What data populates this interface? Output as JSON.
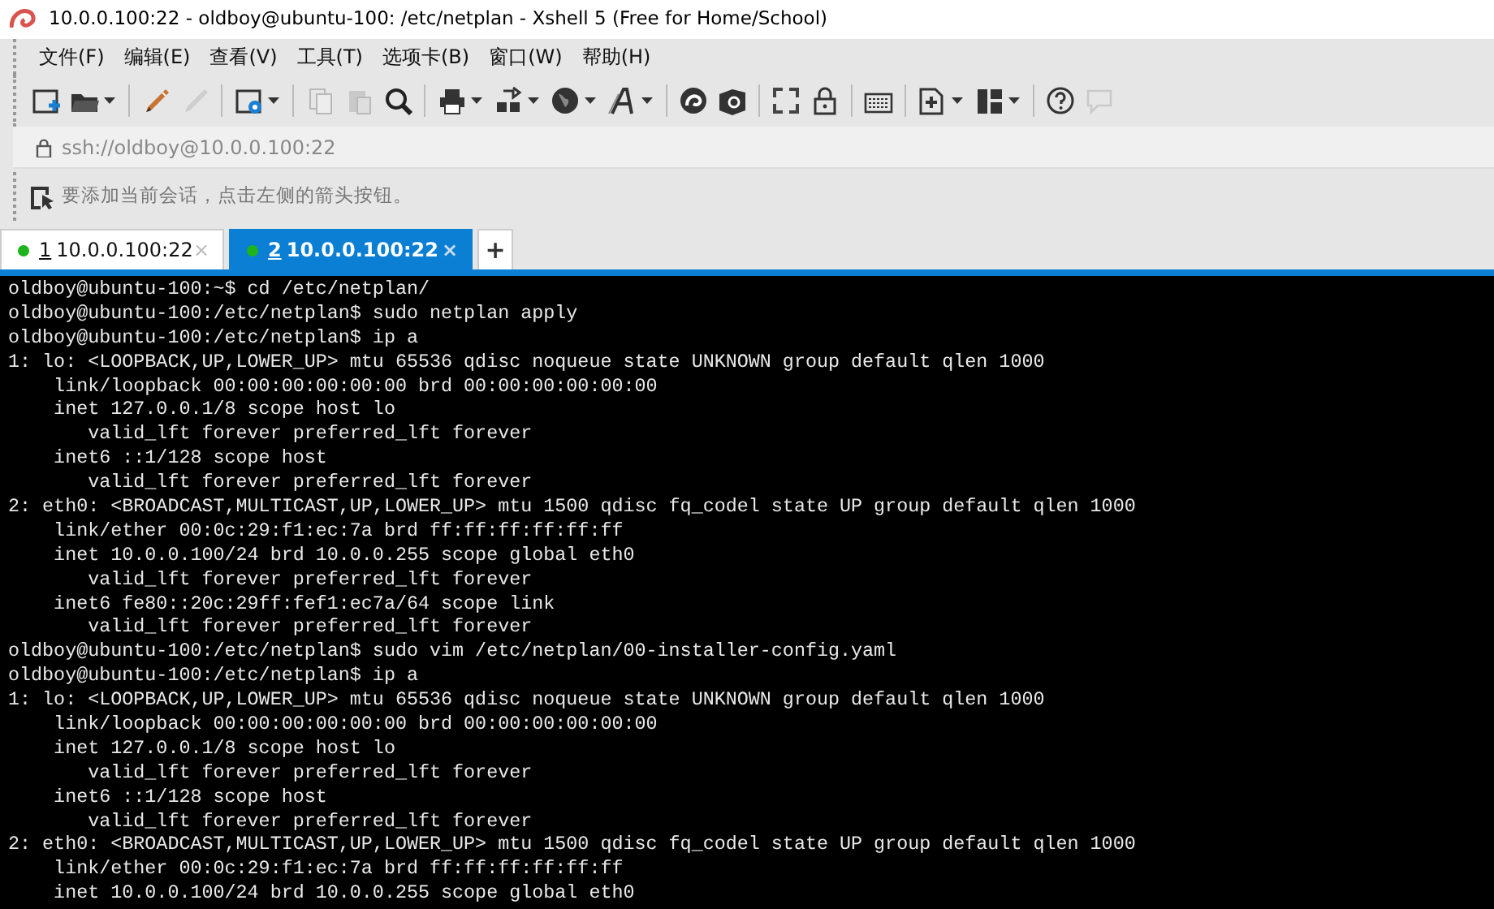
{
  "window": {
    "title": "10.0.0.100:22 - oldboy@ubuntu-100: /etc/netplan - Xshell 5 (Free for Home/School)"
  },
  "menu": [
    "文件(F)",
    "编辑(E)",
    "查看(V)",
    "工具(T)",
    "选项卡(B)",
    "窗口(W)",
    "帮助(H)"
  ],
  "toolbar": [
    {
      "kind": "button",
      "disabled": false,
      "dropdown": false
    },
    {
      "kind": "button",
      "disabled": false,
      "dropdown": true
    },
    {
      "kind": "separator"
    },
    {
      "kind": "button",
      "disabled": false,
      "dropdown": false
    },
    {
      "kind": "button",
      "disabled": true,
      "dropdown": false
    },
    {
      "kind": "separator"
    },
    {
      "kind": "button",
      "disabled": false,
      "dropdown": true
    },
    {
      "kind": "separator"
    },
    {
      "kind": "button",
      "disabled": true,
      "dropdown": false
    },
    {
      "kind": "button",
      "disabled": true,
      "dropdown": false
    },
    {
      "kind": "button",
      "disabled": false,
      "dropdown": false
    },
    {
      "kind": "separator"
    },
    {
      "kind": "button",
      "disabled": false,
      "dropdown": true
    },
    {
      "kind": "button",
      "disabled": false,
      "dropdown": true
    },
    {
      "kind": "button",
      "disabled": false,
      "dropdown": true
    },
    {
      "kind": "button",
      "disabled": false,
      "dropdown": true
    },
    {
      "kind": "separator"
    },
    {
      "kind": "button",
      "disabled": false,
      "dropdown": false
    },
    {
      "kind": "button",
      "disabled": false,
      "dropdown": false
    },
    {
      "kind": "separator"
    },
    {
      "kind": "button",
      "disabled": false,
      "dropdown": false
    },
    {
      "kind": "button",
      "disabled": false,
      "dropdown": false
    },
    {
      "kind": "separator"
    },
    {
      "kind": "button",
      "disabled": false,
      "dropdown": false
    },
    {
      "kind": "separator"
    },
    {
      "kind": "button",
      "disabled": false,
      "dropdown": true
    },
    {
      "kind": "button",
      "disabled": false,
      "dropdown": true
    },
    {
      "kind": "separator"
    },
    {
      "kind": "button",
      "disabled": false,
      "dropdown": false
    },
    {
      "kind": "button",
      "disabled": true,
      "dropdown": false
    }
  ],
  "address_bar": {
    "value": "ssh://oldboy@10.0.0.100:22"
  },
  "session_hint": {
    "text": "要添加当前会话，点击左侧的箭头按钮。"
  },
  "tabs": [
    {
      "number": "1",
      "label": "10.0.0.100:22",
      "connected": true,
      "selected": false,
      "close": "×"
    },
    {
      "number": "2",
      "label": "10.0.0.100:22",
      "connected": true,
      "selected": true,
      "close": "×"
    }
  ],
  "add_tab": "+",
  "terminal": {
    "lines": [
      "oldboy@ubuntu-100:~$ cd /etc/netplan/",
      "oldboy@ubuntu-100:/etc/netplan$ sudo netplan apply",
      "oldboy@ubuntu-100:/etc/netplan$ ip a",
      "1: lo: <LOOPBACK,UP,LOWER_UP> mtu 65536 qdisc noqueue state UNKNOWN group default qlen 1000",
      "    link/loopback 00:00:00:00:00:00 brd 00:00:00:00:00:00",
      "    inet 127.0.0.1/8 scope host lo",
      "       valid_lft forever preferred_lft forever",
      "    inet6 ::1/128 scope host",
      "       valid_lft forever preferred_lft forever",
      "2: eth0: <BROADCAST,MULTICAST,UP,LOWER_UP> mtu 1500 qdisc fq_codel state UP group default qlen 1000",
      "    link/ether 00:0c:29:f1:ec:7a brd ff:ff:ff:ff:ff:ff",
      "    inet 10.0.0.100/24 brd 10.0.0.255 scope global eth0",
      "       valid_lft forever preferred_lft forever",
      "    inet6 fe80::20c:29ff:fef1:ec7a/64 scope link",
      "       valid_lft forever preferred_lft forever",
      "oldboy@ubuntu-100:/etc/netplan$ sudo vim /etc/netplan/00-installer-config.yaml",
      "oldboy@ubuntu-100:/etc/netplan$ ip a",
      "1: lo: <LOOPBACK,UP,LOWER_UP> mtu 65536 qdisc noqueue state UNKNOWN group default qlen 1000",
      "    link/loopback 00:00:00:00:00:00 brd 00:00:00:00:00:00",
      "    inet 127.0.0.1/8 scope host lo",
      "       valid_lft forever preferred_lft forever",
      "    inet6 ::1/128 scope host",
      "       valid_lft forever preferred_lft forever",
      "2: eth0: <BROADCAST,MULTICAST,UP,LOWER_UP> mtu 1500 qdisc fq_codel state UP group default qlen 1000",
      "    link/ether 00:0c:29:f1:ec:7a brd ff:ff:ff:ff:ff:ff",
      "    inet 10.0.0.100/24 brd 10.0.0.255 scope global eth0"
    ]
  }
}
